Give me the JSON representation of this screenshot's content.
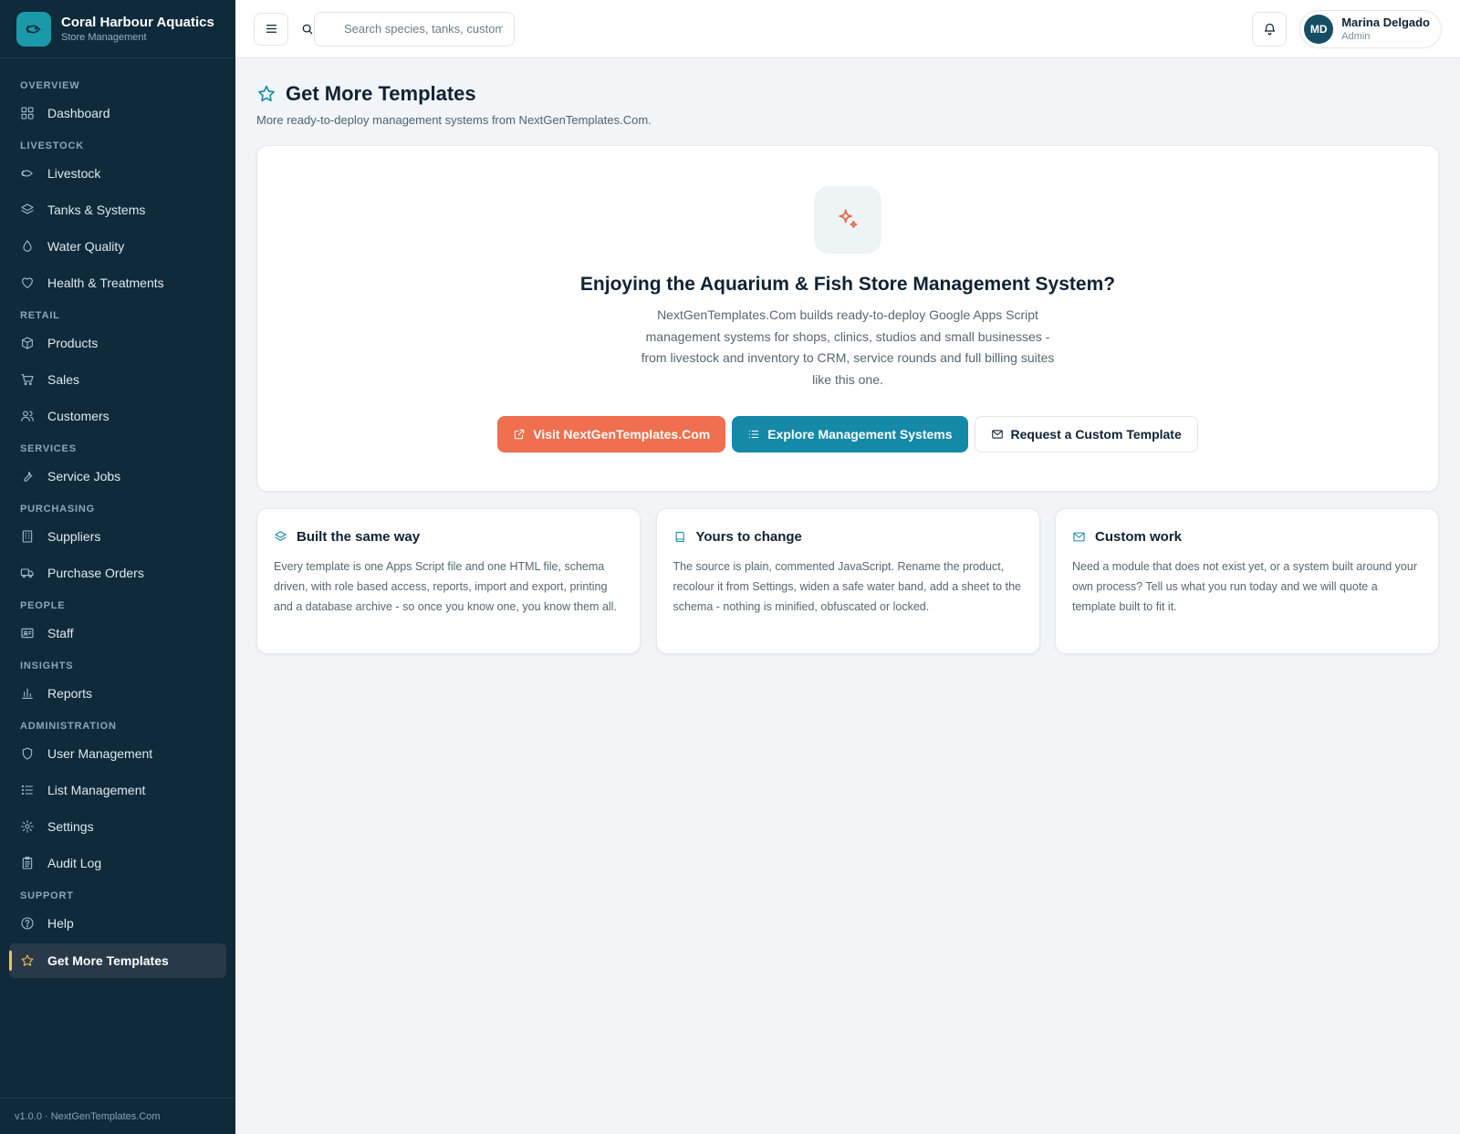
{
  "brand": {
    "title": "Coral Harbour Aquatics",
    "subtitle": "Store Management"
  },
  "sidebar": {
    "sections": [
      {
        "label": "OVERVIEW",
        "items": [
          {
            "label": "Dashboard",
            "icon": "grid-icon"
          }
        ]
      },
      {
        "label": "LIVESTOCK",
        "items": [
          {
            "label": "Livestock",
            "icon": "fish-icon"
          },
          {
            "label": "Tanks & Systems",
            "icon": "layers-icon"
          },
          {
            "label": "Water Quality",
            "icon": "droplet-icon"
          },
          {
            "label": "Health & Treatments",
            "icon": "heart-icon"
          }
        ]
      },
      {
        "label": "RETAIL",
        "items": [
          {
            "label": "Products",
            "icon": "box-icon"
          },
          {
            "label": "Sales",
            "icon": "cart-icon"
          },
          {
            "label": "Customers",
            "icon": "users-icon"
          }
        ]
      },
      {
        "label": "SERVICES",
        "items": [
          {
            "label": "Service Jobs",
            "icon": "wrench-icon"
          }
        ]
      },
      {
        "label": "PURCHASING",
        "items": [
          {
            "label": "Suppliers",
            "icon": "building-icon"
          },
          {
            "label": "Purchase Orders",
            "icon": "truck-icon"
          }
        ]
      },
      {
        "label": "PEOPLE",
        "items": [
          {
            "label": "Staff",
            "icon": "id-card-icon"
          }
        ]
      },
      {
        "label": "INSIGHTS",
        "items": [
          {
            "label": "Reports",
            "icon": "bar-chart-icon"
          }
        ]
      },
      {
        "label": "ADMINISTRATION",
        "items": [
          {
            "label": "User Management",
            "icon": "shield-icon"
          },
          {
            "label": "List Management",
            "icon": "list-icon"
          },
          {
            "label": "Settings",
            "icon": "gear-icon"
          },
          {
            "label": "Audit Log",
            "icon": "clipboard-icon"
          }
        ]
      },
      {
        "label": "SUPPORT",
        "items": [
          {
            "label": "Help",
            "icon": "help-circle-icon"
          },
          {
            "label": "Get More Templates",
            "icon": "star-icon",
            "active": true
          }
        ]
      }
    ],
    "footer": "v1.0.0 · NextGenTemplates.Com"
  },
  "topbar": {
    "search_placeholder": "Search species, tanks, customers...",
    "user": {
      "initials": "MD",
      "name": "Marina Delgado",
      "role": "Admin"
    }
  },
  "page": {
    "title": "Get More Templates",
    "subtitle": "More ready-to-deploy management systems from NextGenTemplates.Com."
  },
  "hero": {
    "title": "Enjoying the Aquarium & Fish Store Management System?",
    "text": "NextGenTemplates.Com builds ready-to-deploy Google Apps Script management systems for shops, clinics, studios and small businesses - from livestock and inventory to CRM, service rounds and full billing suites like this one.",
    "buttons": {
      "visit": "Visit NextGenTemplates.Com",
      "explore": "Explore Management Systems",
      "request": "Request a Custom Template"
    }
  },
  "cards": [
    {
      "title": "Built the same way",
      "icon": "layers-icon",
      "text": "Every template is one Apps Script file and one HTML file, schema driven, with role based access, reports, import and export, printing and a database archive - so once you know one, you know them all."
    },
    {
      "title": "Yours to change",
      "icon": "book-icon",
      "text": "The source is plain, commented JavaScript. Rename the product, recolour it from Settings, widen a safe water band, add a sheet to the schema - nothing is minified, obfuscated or locked."
    },
    {
      "title": "Custom work",
      "icon": "mail-icon",
      "text": "Need a module that does not exist yet, or a system built around your own process? Tell us what you run today and we will quote a template built to fit it."
    }
  ],
  "colors": {
    "sidebar": "#0f2a3b",
    "accent_teal": "#1489a8",
    "accent_orange": "#ef6f4e",
    "active_marker": "#f2c14e"
  }
}
